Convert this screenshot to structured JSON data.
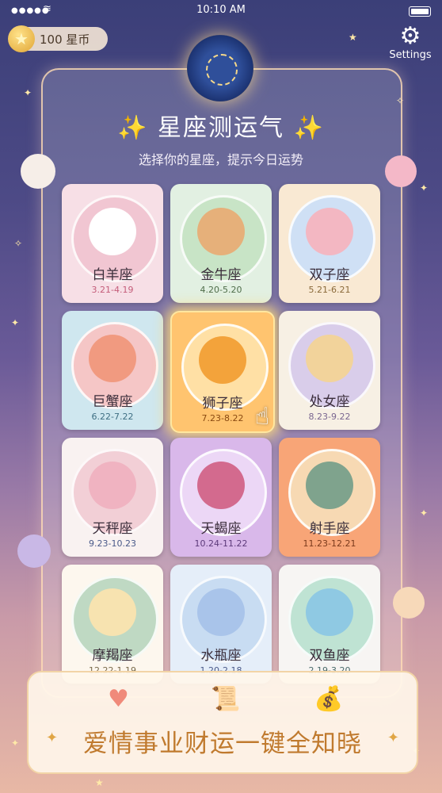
{
  "status_bar": {
    "time": "10:10 AM"
  },
  "header": {
    "coins_label": "100 星币",
    "settings_label": "Settings",
    "title": "星座测运气",
    "subtitle": "选择你的星座，提示今日运势"
  },
  "colors": {
    "accent": "#ffd34f",
    "banner_text": "#c07a2e"
  },
  "zodiac": [
    {
      "name": "白羊座",
      "date": "3.21-4.19",
      "bg": "#f7dfe6",
      "ring": "#f1c6d2",
      "mascot": "#ffffff",
      "date_color": "#c45d7a"
    },
    {
      "name": "金牛座",
      "date": "4.20-5.20",
      "bg": "#e2f0e2",
      "ring": "#c8e4c6",
      "mascot": "#e6b07a",
      "date_color": "#4f6d4a"
    },
    {
      "name": "双子座",
      "date": "5.21-6.21",
      "bg": "#f9e9d3",
      "ring": "#cfe0f5",
      "mascot": "#f3b7c2",
      "date_color": "#8a6a3a"
    },
    {
      "name": "巨蟹座",
      "date": "6.22-7.22",
      "bg": "#cfe7ef",
      "ring": "#f5c6c6",
      "mascot": "#f19a80",
      "date_color": "#3f6f83"
    },
    {
      "name": "狮子座",
      "date": "7.23-8.22",
      "bg": "#ffc46f",
      "ring": "#ffe0a5",
      "mascot": "#f3a33b",
      "date_color": "#8a4a12"
    },
    {
      "name": "处女座",
      "date": "8.23-9.22",
      "bg": "#f7f0e4",
      "ring": "#d9cdea",
      "mascot": "#f2d39b",
      "date_color": "#7a6690"
    },
    {
      "name": "天秤座",
      "date": "9.23-10.23",
      "bg": "#f9f2f1",
      "ring": "#f2cfd6",
      "mascot": "#f0b3c1",
      "date_color": "#4a5a8a"
    },
    {
      "name": "天蝎座",
      "date": "10.24-11.22",
      "bg": "#d9b8ea",
      "ring": "#ecd7f6",
      "mascot": "#d36a8e",
      "date_color": "#5c3a7a"
    },
    {
      "name": "射手座",
      "date": "11.23-12.21",
      "bg": "#f8a577",
      "ring": "#f7d9b3",
      "mascot": "#7fa38d",
      "date_color": "#7a3a1c"
    },
    {
      "name": "摩羯座",
      "date": "12.22-1.19",
      "bg": "#fdf7ee",
      "ring": "#bfd9c3",
      "mascot": "#f7e3b0",
      "date_color": "#7a6a4a"
    },
    {
      "name": "水瓶座",
      "date": "1.20-2.18",
      "bg": "#e5eef9",
      "ring": "#c8dcf2",
      "mascot": "#a9c4ea",
      "date_color": "#4a5a8a"
    },
    {
      "name": "双鱼座",
      "date": "2.19-3.20",
      "bg": "#f7f5f3",
      "ring": "#bfe3d3",
      "mascot": "#8fc9e3",
      "date_color": "#4a6a6a"
    }
  ],
  "selected_sign": "狮子座",
  "banner": {
    "icons": [
      "heart-icon",
      "scroll-icon",
      "money-bag-icon"
    ],
    "text": "爱情事业财运一键全知晓"
  }
}
